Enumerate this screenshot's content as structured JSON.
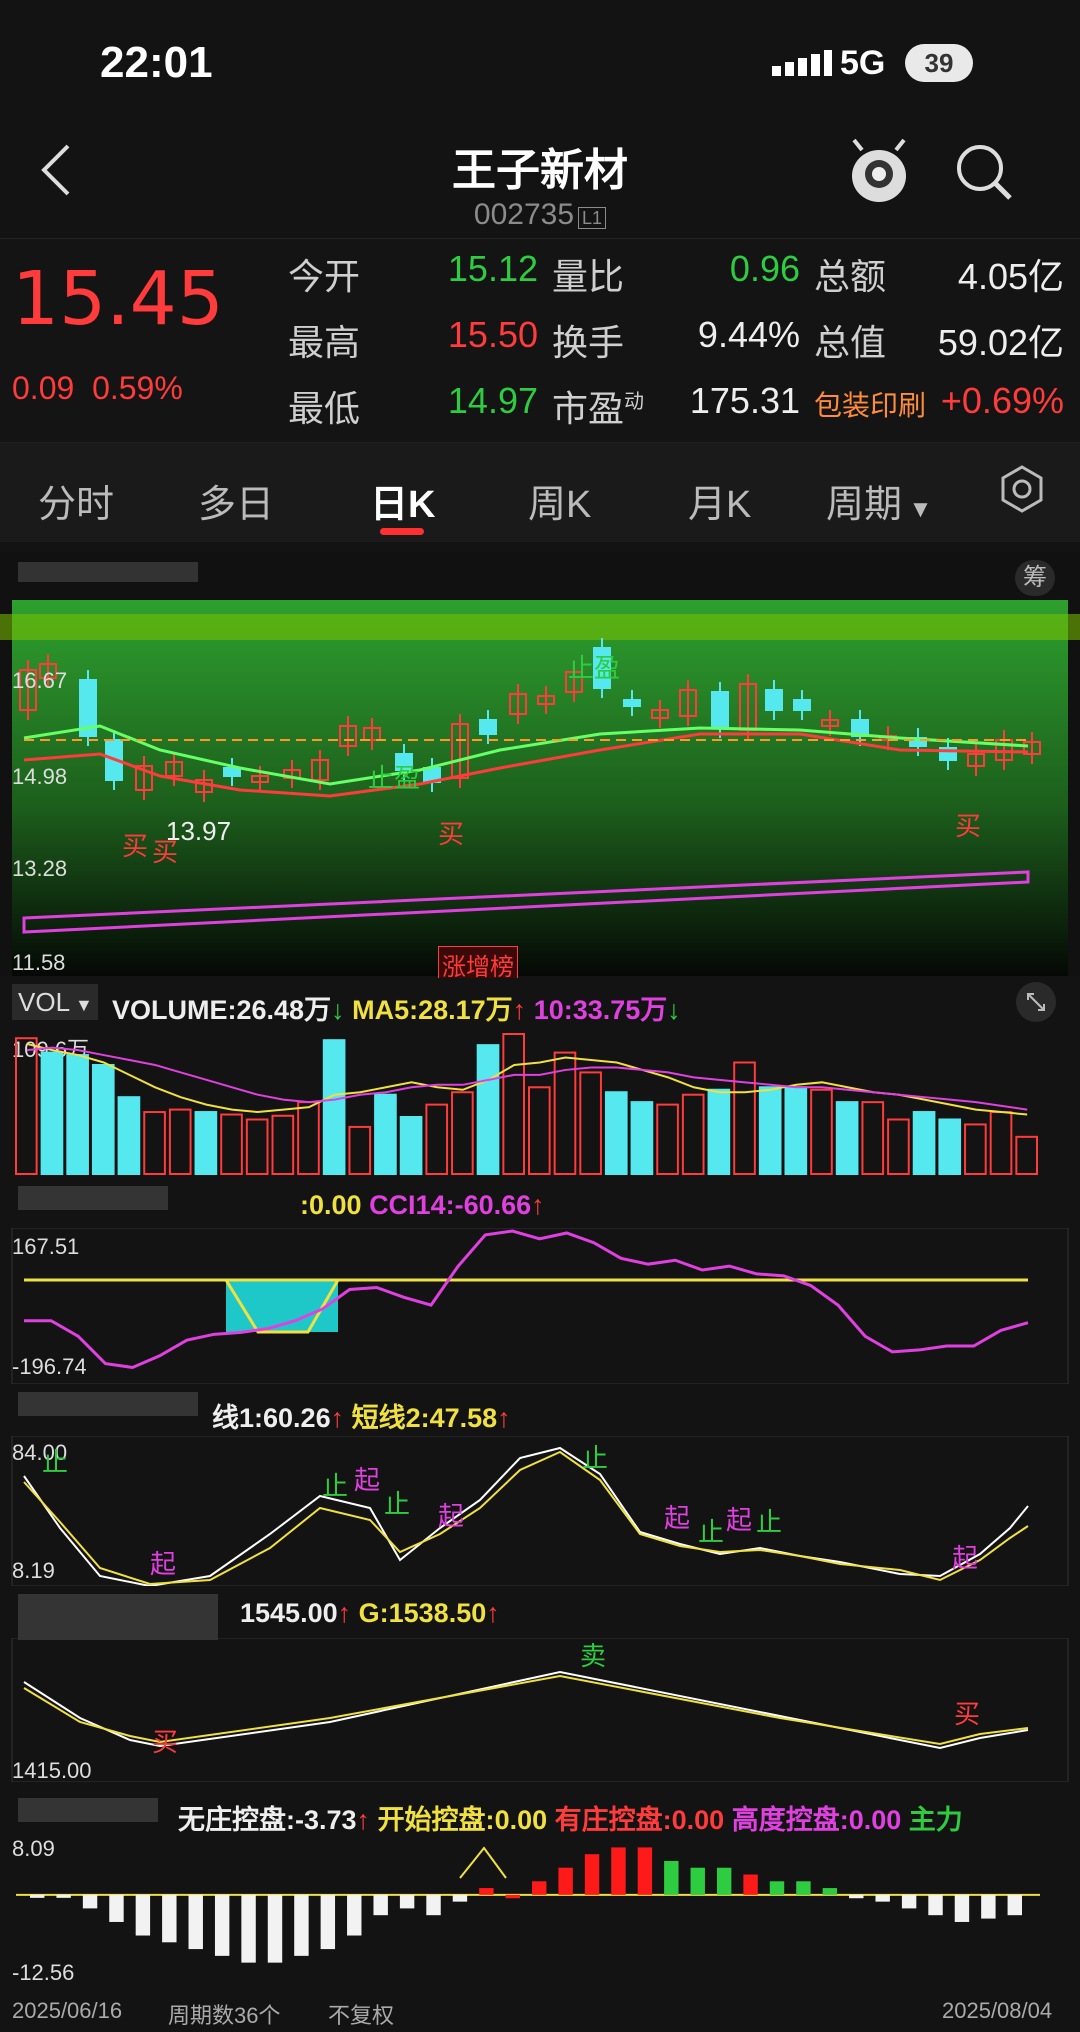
{
  "status_bar": {
    "time": "22:01",
    "network": "5G",
    "battery": "39"
  },
  "header": {
    "title": "王子新材",
    "code": "002735",
    "level_badge": "L1"
  },
  "quote": {
    "price": "15.45",
    "change": "0.09",
    "change_pct": "0.59%",
    "rows": [
      {
        "l1": "今开",
        "v1": "15.12",
        "l2": "量比",
        "v2": "0.96",
        "l3": "总额",
        "v3": "4.05亿"
      },
      {
        "l1": "最高",
        "v1": "15.50",
        "l2": "换手",
        "v2": "9.44%",
        "l3": "总值",
        "v3": "59.02亿"
      },
      {
        "l1": "最低",
        "v1": "14.97",
        "l2": "市盈",
        "l2_sup": "动",
        "v2": "175.31",
        "l3": "包装印刷",
        "v3": "+0.69%"
      }
    ]
  },
  "tabs": [
    "分时",
    "多日",
    "日K",
    "周K",
    "月K",
    "周期"
  ],
  "active_tab": "日K",
  "kline": {
    "y_labels": [
      "16.67",
      "14.98",
      "13.28",
      "11.58"
    ],
    "min_label": "13.97",
    "signal_labels": [
      "止盈",
      "止盈",
      "买",
      "买",
      "买",
      "买"
    ],
    "ranking_badge": "涨增榜",
    "chip_button": "筹"
  },
  "volume": {
    "selector": "VOL",
    "volume_label": "VOLUME:",
    "volume_value": "26.48万",
    "volume_arrow": "↓",
    "ma5_label": "MA5:",
    "ma5_value": "28.17万",
    "ma5_arrow": "↑",
    "ma10_label": "10:",
    "ma10_value": "33.75万",
    "ma10_arrow": "↓",
    "y_top": "109.6万",
    "values": [
      109.6,
      98,
      96,
      88,
      62,
      50,
      52,
      50,
      48,
      44,
      47,
      58,
      108,
      38,
      64,
      46,
      56,
      66,
      104,
      113,
      70,
      98,
      82,
      66,
      58,
      56,
      64,
      68,
      90,
      70,
      70,
      68,
      58,
      58,
      44,
      50,
      44,
      40,
      50,
      30
    ],
    "cyan_flags": [
      0,
      1,
      1,
      1,
      1,
      0,
      0,
      1,
      0,
      0,
      0,
      0,
      1,
      0,
      1,
      1,
      0,
      0,
      1,
      0,
      0,
      0,
      0,
      1,
      1,
      0,
      0,
      1,
      0,
      1,
      1,
      0,
      1,
      0,
      0,
      1,
      1,
      0,
      0,
      0
    ],
    "ma5": [
      105,
      100,
      96,
      90,
      80,
      70,
      62,
      56,
      52,
      50,
      52,
      54,
      64,
      66,
      70,
      74,
      70,
      68,
      76,
      88,
      90,
      94,
      92,
      90,
      84,
      78,
      70,
      66,
      66,
      68,
      72,
      74,
      70,
      66,
      64,
      60,
      56,
      52,
      50,
      48
    ],
    "ma10": [
      100,
      102,
      100,
      96,
      92,
      88,
      82,
      76,
      70,
      64,
      60,
      58,
      60,
      64,
      66,
      70,
      72,
      72,
      76,
      80,
      80,
      84,
      86,
      86,
      84,
      82,
      78,
      76,
      74,
      72,
      70,
      70,
      68,
      66,
      64,
      62,
      60,
      58,
      55,
      52
    ]
  },
  "cci": {
    "head_value": ":0.00",
    "cci_label": "CCI14:",
    "cci_value": "-60.66",
    "cci_arrow": "↑",
    "y_top": "167.51",
    "y_bottom": "-196.74",
    "values": [
      -60,
      -60,
      -100,
      -170,
      -180,
      -150,
      -110,
      -95,
      -90,
      -80,
      -60,
      -30,
      20,
      25,
      0,
      -20,
      80,
      160,
      170,
      150,
      165,
      140,
      100,
      85,
      95,
      70,
      80,
      60,
      55,
      30,
      -20,
      -100,
      -140,
      -135,
      -125,
      -125,
      -85,
      -65
    ]
  },
  "short_line": {
    "l1_label": "线1:",
    "l1_value": "60.26",
    "l1_arrow": "↑",
    "l2_label": "短线2:",
    "l2_value": "47.58",
    "l2_arrow": "↑",
    "y_top": "84.00",
    "y_bottom": "8.19",
    "signals": [
      "止",
      "起",
      "止",
      "起",
      "止",
      "起",
      "止",
      "起",
      "起",
      "止",
      "止",
      "起"
    ]
  },
  "g_line": {
    "head_value": "1545.00",
    "head_arrow": "↑",
    "g_label": "G:",
    "g_value": "1538.50",
    "g_arrow": "↑",
    "y_bottom": "1415.00",
    "signals": [
      "买",
      "卖",
      "买"
    ]
  },
  "control": {
    "items": [
      {
        "label": "无庄控盘:",
        "value": "-3.73",
        "arrow": "↑"
      },
      {
        "label": "开始控盘:",
        "value": "0.00"
      },
      {
        "label": "有庄控盘:",
        "value": "0.00"
      },
      {
        "label": "高度控盘:",
        "value": "0.00"
      },
      {
        "label": "主力"
      }
    ],
    "y_top": "8.09",
    "y_bottom": "-12.56",
    "values": [
      -0.2,
      -0.4,
      -2,
      -4,
      -6,
      -7,
      -8,
      -9,
      -10,
      -10,
      -9,
      -8,
      -6,
      -3,
      -2,
      -3,
      -1,
      1,
      -0.5,
      2,
      4,
      6,
      7,
      7,
      5,
      4,
      4,
      3,
      2,
      2,
      1,
      -0.5,
      -1,
      -2,
      -3,
      -4,
      -3.5,
      -3
    ],
    "colors": [
      "w",
      "w",
      "w",
      "w",
      "w",
      "w",
      "w",
      "w",
      "w",
      "w",
      "w",
      "w",
      "w",
      "w",
      "w",
      "w",
      "w",
      "r",
      "r",
      "r",
      "r",
      "r",
      "r",
      "r",
      "g",
      "g",
      "g",
      "r",
      "g",
      "g",
      "g",
      "w",
      "w",
      "w",
      "w",
      "w",
      "w",
      "w"
    ]
  },
  "footer": {
    "start_date": "2025/06/16",
    "period_count": "周期数36个",
    "adjust": "不复权",
    "end_date": "2025/08/04"
  },
  "colors": {
    "up": "#ff3b3b",
    "down": "#55e8ee",
    "ma5": "#f0e040",
    "ma10": "#e040e0"
  }
}
